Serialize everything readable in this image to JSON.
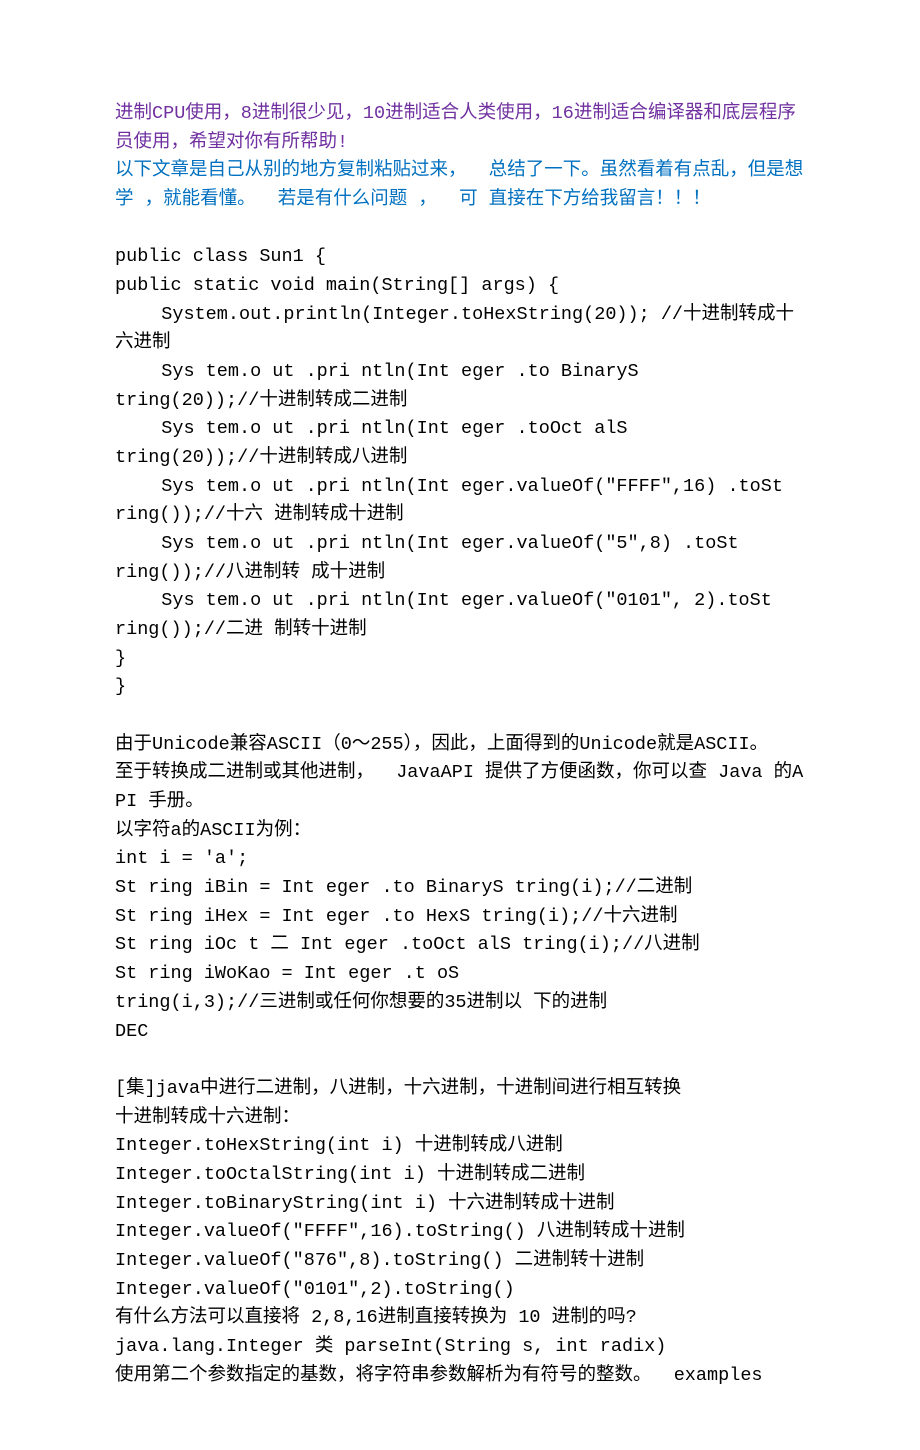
{
  "lines": [
    {
      "cls": "line purple",
      "text": "进制CPU使用，8进制很少见，10进制适合人类使用，16进制适合编译器和底层程序员使用，希望对你有所帮助!"
    },
    {
      "cls": "line blue",
      "text": "以下文章是自己从别的地方复制粘贴过来，  总结了一下。虽然看着有点乱，但是想学 ，就能看懂。  若是有什么问题 ，  可 直接在下方给我留言！！！"
    },
    {
      "cls": "blank",
      "text": ""
    },
    {
      "cls": "line",
      "text": "public class Sun1 {"
    },
    {
      "cls": "line",
      "text": "public static void main(String[] args) {"
    },
    {
      "cls": "line indent",
      "text": "System.out.println(Integer.toHexString(20)); //十进制转成十六进制"
    },
    {
      "cls": "line indent",
      "text": "Sys tem.o ut .pri ntln(Int eger .to BinaryS"
    },
    {
      "cls": "line",
      "text": "tring(20));//十进制转成二进制"
    },
    {
      "cls": "line indent",
      "text": "Sys tem.o ut .pri ntln(Int eger .toOct alS"
    },
    {
      "cls": "line",
      "text": "tring(20));//十进制转成八进制"
    },
    {
      "cls": "line indent",
      "text": "Sys tem.o ut .pri ntln(Int eger.valueOf(\"FFFF\",16) .toSt"
    },
    {
      "cls": "line",
      "text": "ring());//十六 进制转成十进制"
    },
    {
      "cls": "line indent",
      "text": "Sys tem.o ut .pri ntln(Int eger.valueOf(\"5\",8) .toSt"
    },
    {
      "cls": "line",
      "text": "ring());//八进制转 成十进制"
    },
    {
      "cls": "line indent",
      "text": "Sys tem.o ut .pri ntln(Int eger.valueOf(\"0101\", 2).toSt"
    },
    {
      "cls": "line",
      "text": "ring());//二进 制转十进制"
    },
    {
      "cls": "line",
      "text": "}"
    },
    {
      "cls": "line",
      "text": "}"
    },
    {
      "cls": "blank",
      "text": ""
    },
    {
      "cls": "line",
      "text": "由于Unicode兼容ASCII（0〜255），因此，上面得到的Unicode就是ASCII。"
    },
    {
      "cls": "line",
      "text": "至于转换成二进制或其他进制，  JavaAPI 提供了方便函数，你可以查 Java 的API 手册。"
    },
    {
      "cls": "line",
      "text": "以字符a的ASCII为例："
    },
    {
      "cls": "line",
      "text": "int i = 'a';"
    },
    {
      "cls": "line",
      "text": "St ring iBin = Int eger .to BinaryS tring(i);//二进制"
    },
    {
      "cls": "line",
      "text": "St ring iHex = Int eger .to HexS tring(i);//十六进制"
    },
    {
      "cls": "line",
      "text": "St ring iOc t 二 Int eger .toOct alS tring(i);//八进制"
    },
    {
      "cls": "line",
      "text": "St ring iWoKao = Int eger .t oS"
    },
    {
      "cls": "line",
      "text": "tring(i,3);//三进制或任何你想要的35进制以 下的进制"
    },
    {
      "cls": "line",
      "text": "DEC"
    },
    {
      "cls": "blank",
      "text": ""
    },
    {
      "cls": "line",
      "text": "[集]java中进行二进制，八进制，十六进制，十进制间进行相互转换"
    },
    {
      "cls": "line",
      "text": "十进制转成十六进制："
    },
    {
      "cls": "line",
      "text": "Integer.toHexString(int i) 十进制转成八进制"
    },
    {
      "cls": "line",
      "text": "Integer.toOctalString(int i) 十进制转成二进制"
    },
    {
      "cls": "line",
      "text": "Integer.toBinaryString(int i) 十六进制转成十进制"
    },
    {
      "cls": "line",
      "text": "Integer.valueOf(\"FFFF\",16).toString() 八进制转成十进制"
    },
    {
      "cls": "line",
      "text": "Integer.valueOf(\"876\",8).toString() 二进制转十进制"
    },
    {
      "cls": "line",
      "text": "Integer.valueOf(\"0101\",2).toString()"
    },
    {
      "cls": "line",
      "text": "有什么方法可以直接将 2,8,16进制直接转换为 10 进制的吗?"
    },
    {
      "cls": "line",
      "text": "java.lang.Integer 类 parseInt(String s, int radix)"
    },
    {
      "cls": "line",
      "text": "使用第二个参数指定的基数，将字符串参数解析为有符号的整数。  examples"
    }
  ]
}
